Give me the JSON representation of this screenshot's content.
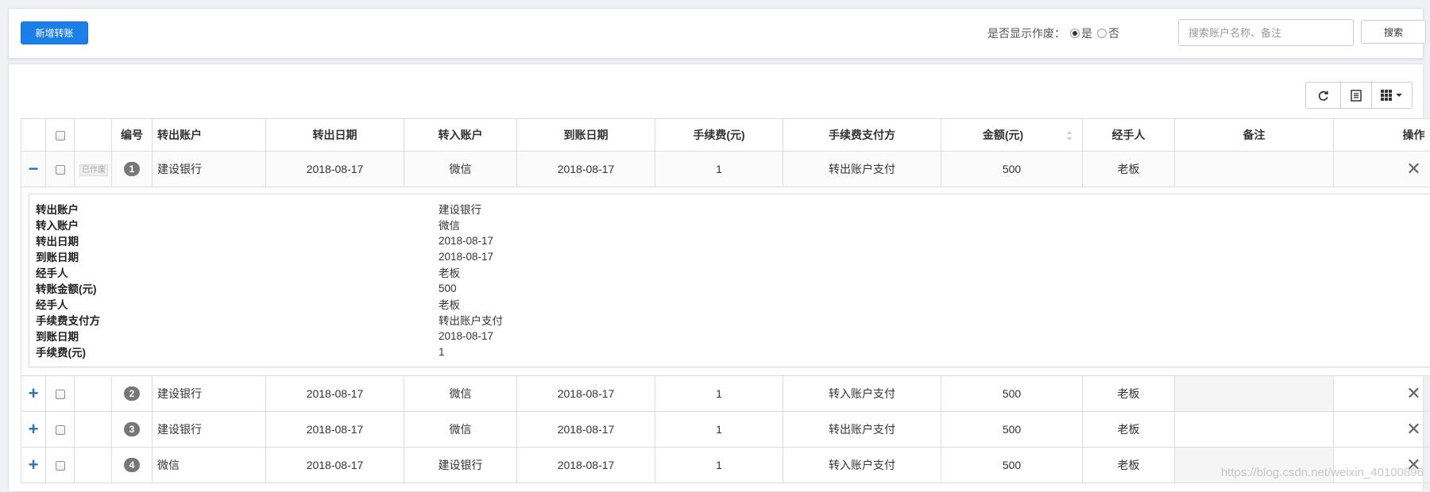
{
  "toolbar": {
    "add_button": "新增转账",
    "void_filter_label": "是否显示作废：",
    "void_yes": "是",
    "void_no": "否",
    "search_placeholder": "搜索账户名称、备注",
    "search_button": "搜索"
  },
  "table": {
    "headers": {
      "number": "编号",
      "from_account": "转出账户",
      "out_date": "转出日期",
      "to_account": "转入账户",
      "arrival_date": "到账日期",
      "fee": "手续费(元)",
      "fee_payer": "手续费支付方",
      "amount": "金额(元)",
      "handler": "经手人",
      "remark": "备注",
      "action": "操作"
    },
    "void_tag": "已作废",
    "rows": [
      {
        "expand": "−",
        "no": "1",
        "from": "建设银行",
        "out_date": "2018-08-17",
        "to": "微信",
        "arrival": "2018-08-17",
        "fee": "1",
        "payer": "转出账户支付",
        "amount": "500",
        "handler": "老板",
        "remark": ""
      },
      {
        "expand": "+",
        "no": "2",
        "from": "建设银行",
        "out_date": "2018-08-17",
        "to": "微信",
        "arrival": "2018-08-17",
        "fee": "1",
        "payer": "转入账户支付",
        "amount": "500",
        "handler": "老板",
        "remark": ""
      },
      {
        "expand": "+",
        "no": "3",
        "from": "建设银行",
        "out_date": "2018-08-17",
        "to": "微信",
        "arrival": "2018-08-17",
        "fee": "1",
        "payer": "转出账户支付",
        "amount": "500",
        "handler": "老板",
        "remark": ""
      },
      {
        "expand": "+",
        "no": "4",
        "from": "微信",
        "out_date": "2018-08-17",
        "to": "建设银行",
        "arrival": "2018-08-17",
        "fee": "1",
        "payer": "转入账户支付",
        "amount": "500",
        "handler": "老板",
        "remark": ""
      }
    ],
    "detail": [
      {
        "k": "转出账户",
        "v": "建设银行"
      },
      {
        "k": "转入账户",
        "v": "微信"
      },
      {
        "k": "转出日期",
        "v": "2018-08-17"
      },
      {
        "k": "到账日期",
        "v": "2018-08-17"
      },
      {
        "k": "经手人",
        "v": "老板"
      },
      {
        "k": "转账金额(元)",
        "v": "500"
      },
      {
        "k": "经手人",
        "v": "老板"
      },
      {
        "k": "手续费支付方",
        "v": "转出账户支付"
      },
      {
        "k": "到账日期",
        "v": "2018-08-17"
      },
      {
        "k": "手续费(元)",
        "v": "1"
      }
    ]
  },
  "watermark": "https://blog.csdn.net/weixin_40100896",
  "icons": [
    "refresh-icon",
    "list-view-icon",
    "columns-icon",
    "caret-down-icon",
    "close-icon",
    "sort-icon"
  ],
  "colors": {
    "primary": "#1c7ee8",
    "expand": "#2a73bb",
    "badge": "#777777"
  }
}
